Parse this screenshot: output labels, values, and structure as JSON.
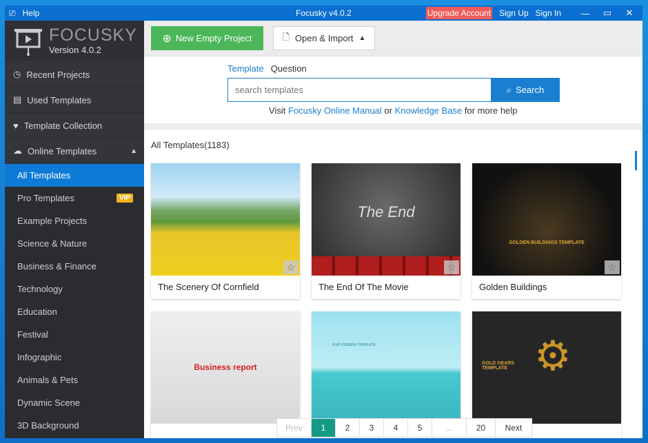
{
  "titlebar": {
    "help": "Help",
    "title": "Focusky v4.0.2",
    "upgrade": "Upgrade Account",
    "sign_up": "Sign Up",
    "sign_in": "Sign In"
  },
  "logo": {
    "brand": "FOCUSKY",
    "version": "Version 4.0.2"
  },
  "sidebar": {
    "top_items": [
      {
        "label": "Recent Projects",
        "icon": "clock-icon"
      },
      {
        "label": "Used Templates",
        "icon": "list-icon"
      },
      {
        "label": "Template Collection",
        "icon": "heart-folder-icon"
      },
      {
        "label": "Online Templates",
        "icon": "cloud-icon"
      }
    ],
    "sub_items": [
      "All Templates",
      "Pro Templates",
      "Example Projects",
      "Science & Nature",
      "Business & Finance",
      "Technology",
      "Education",
      "Festival",
      "Infographic",
      "Animals & Pets",
      "Dynamic Scene",
      "3D Background"
    ],
    "active": "All Templates",
    "vip": "VIP"
  },
  "toolbar": {
    "new_project": "New Empty Project",
    "open_import": "Open & Import"
  },
  "search": {
    "tab_template": "Template",
    "tab_question": "Question",
    "placeholder": "search templates",
    "button": "Search",
    "help_prefix": "Visit",
    "manual_link": "Focusky Online Manual",
    "or": "or",
    "kb_link": "Knowledge Base",
    "help_suffix": "for more help"
  },
  "templates": {
    "heading": "All Templates(1183)",
    "items": [
      "The Scenery Of Cornfield",
      "The End Of The Movie",
      "Golden Buildings",
      "",
      "",
      ""
    ],
    "thumb_text": {
      "t2": "The End",
      "t3": "GOLDEN BUILDINGS TEMPLATE",
      "t4": "Business report",
      "t5": "FLAT ICEBERG TEMPLATE",
      "t6": "GOLD GEARS TEMPLATE"
    }
  },
  "pagination": {
    "prev": "Prev",
    "pages": [
      "1",
      "2",
      "3",
      "4",
      "5",
      "...",
      "20"
    ],
    "current": "1",
    "next": "Next"
  }
}
